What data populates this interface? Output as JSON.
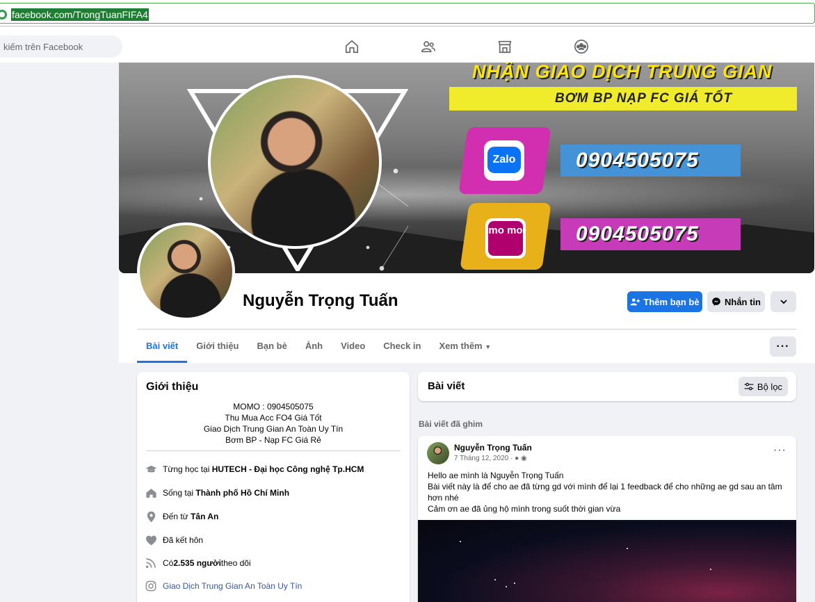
{
  "browser": {
    "url": "facebook.com/TrongTuanFIFA4"
  },
  "fbnav": {
    "search_placeholder": "kiếm trên Facebook",
    "icons": [
      "home-icon",
      "friends-icon",
      "marketplace-icon",
      "groups-icon"
    ]
  },
  "cover": {
    "headline": "NHẬN GIAO DỊCH TRUNG GIAN",
    "subline": "BƠM BP NẠP FC GIÁ TỐT",
    "zalo_label": "Zalo",
    "zalo_phone": "0904505075",
    "momo_label": "mo mo",
    "momo_phone": "0904505075"
  },
  "profile": {
    "name": "Nguyễn Trọng Tuấn",
    "add_friend": "Thêm bạn bè",
    "message": "Nhắn tin"
  },
  "tabs": [
    "Bài viết",
    "Giới thiệu",
    "Bạn bè",
    "Ảnh",
    "Video",
    "Check in",
    "Xem thêm"
  ],
  "intro": {
    "title": "Giới thiệu",
    "bio": [
      "MOMO : 0904505075",
      "Thu Mua Acc FO4 Giá Tốt",
      "Giao Dịch Trung Gian An Toàn Uy Tín",
      "Bơm BP - Nạp FC Giá Rẻ"
    ],
    "study_prefix": "Từng học tại ",
    "study": "HUTECH - Đại học Công nghệ Tp.HCM",
    "live_prefix": "Sống tại ",
    "live": "Thành phố Hồ Chí Minh",
    "from_prefix": "Đến từ ",
    "from": "Tân An",
    "relationship": "Đã kết hôn",
    "followers_prefix": "Có ",
    "followers": "2.535 người",
    "followers_suffix": " theo dõi",
    "instagram": "Giao Dịch Trung Gian An Toàn Uy Tín"
  },
  "posts": {
    "title": "Bài viết",
    "filter": "Bộ lọc",
    "pinned_label": "Bài viết đã ghim",
    "post": {
      "author": "Nguyễn Trọng Tuấn",
      "date": "7 Tháng 12, 2020 ·",
      "lines": [
        "Hello ae mình là Nguyễn Trọng Tuấn",
        "Bài viết này là để cho ae đã từng gd với mình để lại 1 feedback để cho những ae gd sau an tâm hơn nhé",
        "Cảm ơn ae đã ủng hộ mình trong suốt thời gian vừa"
      ]
    }
  }
}
